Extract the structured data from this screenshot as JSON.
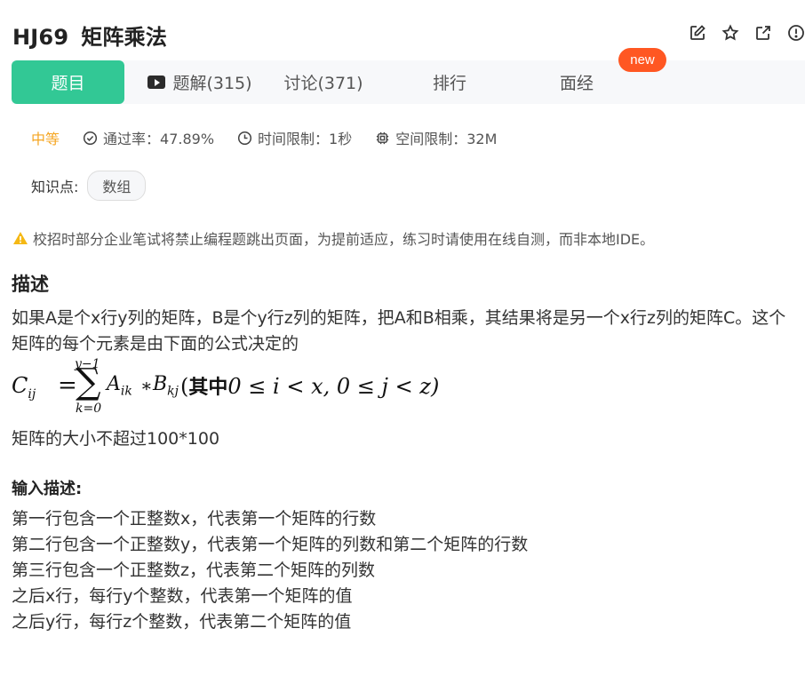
{
  "header": {
    "code": "HJ69",
    "name": "矩阵乘法",
    "icons": [
      "edit-icon",
      "star-icon",
      "external-link-icon",
      "alert-icon"
    ]
  },
  "tabs": {
    "problem": "题目",
    "solutions": "题解(315)",
    "discussion": "讨论(371)",
    "ranking": "排行",
    "interview": "面经",
    "new_badge": "new"
  },
  "meta": {
    "difficulty": "中等",
    "pass_rate": "通过率：47.89%",
    "time_limit": "时间限制：1秒",
    "memory_limit": "空间限制：32M"
  },
  "knowledge": {
    "label": "知识点:",
    "tag": "数组"
  },
  "notice": "校招时部分企业笔试将禁止编程题跳出页面，为提前适应，练习时请使用在线自测，而非本地IDE。",
  "description": {
    "heading": "描述",
    "line1": "如果A是个x行y列的矩阵，B是个y行z列的矩阵，把A和B相乘，其结果将是另一个x行z列的矩阵C。这个",
    "line2": "矩阵的每个元素是由下面的公式决定的",
    "formula": {
      "lhs": "C",
      "lhs_sub": "ij",
      "eq": "=",
      "sum_sym": "∑",
      "sum_top": "y−1",
      "sum_bottom": "k=0",
      "a": "A",
      "a_sub": "ik",
      "mul": "∗",
      "b": "B",
      "b_sub": "kj",
      "cond_open": "(",
      "cond_cn": "其中",
      "cond_expr": "0 ≤ i < x, 0 ≤ j < z)"
    },
    "line3": "矩阵的大小不超过100*100"
  },
  "input": {
    "heading": "输入描述:",
    "lines": [
      "第一行包含一个正整数x，代表第一个矩阵的行数",
      "第二行包含一个正整数y，代表第一个矩阵的列数和第二个矩阵的行数",
      "第三行包含一个正整数z，代表第二个矩阵的列数",
      "之后x行，每行y个整数，代表第一个矩阵的值",
      "之后y行，每行z个整数，代表第二个矩阵的值"
    ]
  },
  "colors": {
    "accent": "#32c895",
    "difficulty": "#f5a623",
    "badge": "#ff5722"
  }
}
